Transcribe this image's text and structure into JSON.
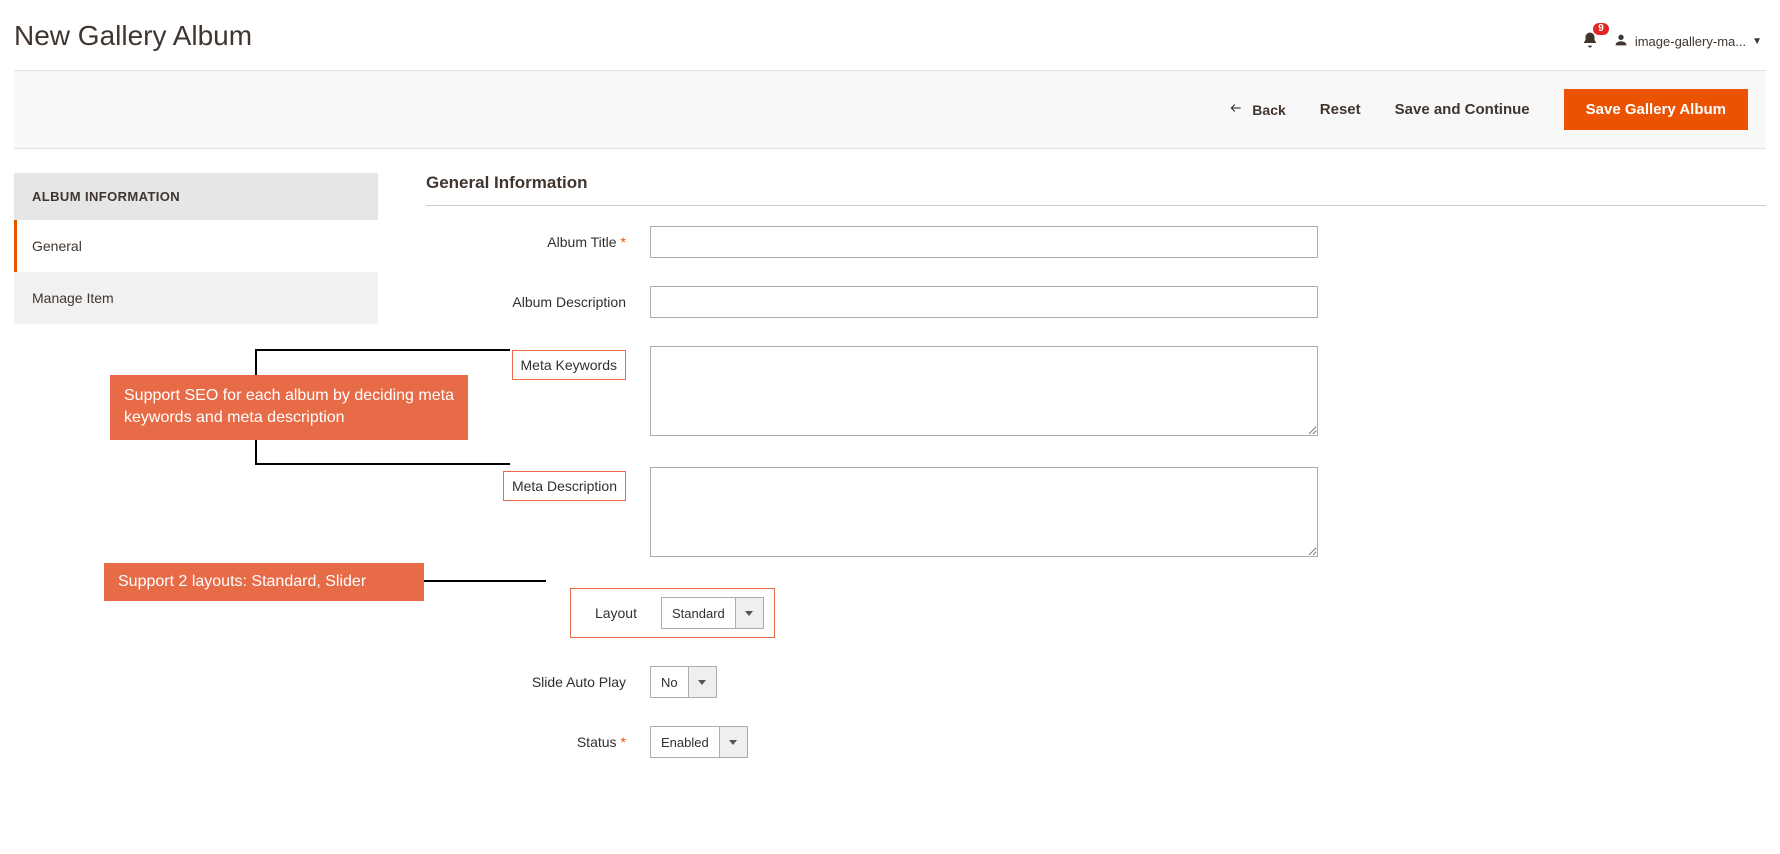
{
  "header": {
    "title": "New Gallery Album",
    "notification_count": "9",
    "username": "image-gallery-ma..."
  },
  "actions": {
    "back": "Back",
    "reset": "Reset",
    "save_continue": "Save and Continue",
    "save": "Save Gallery Album"
  },
  "sidebar": {
    "title": "ALBUM INFORMATION",
    "tabs": {
      "general": "General",
      "manage_item": "Manage Item"
    }
  },
  "section": {
    "title": "General Information"
  },
  "fields": {
    "album_title": {
      "label": "Album Title",
      "required": "*",
      "value": ""
    },
    "album_description": {
      "label": "Album Description",
      "value": ""
    },
    "meta_keywords": {
      "label": "Meta Keywords",
      "value": ""
    },
    "meta_description": {
      "label": "Meta Description",
      "value": ""
    },
    "layout": {
      "label": "Layout",
      "value": "Standard"
    },
    "slide_auto_play": {
      "label": "Slide Auto Play",
      "value": "No"
    },
    "status": {
      "label": "Status",
      "required": "*",
      "value": "Enabled"
    }
  },
  "annotations": {
    "seo": "Support SEO for each album by deciding meta keywords and meta description",
    "layout": "Support 2 layouts: Standard, Slider"
  }
}
